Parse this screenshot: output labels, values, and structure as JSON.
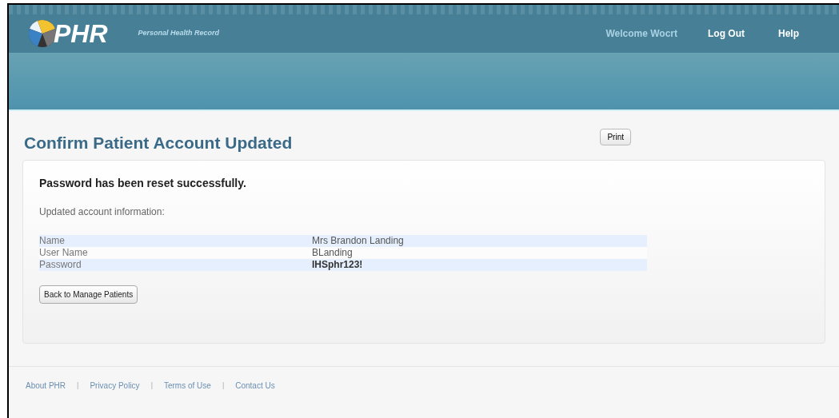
{
  "header": {
    "logo": "PHR",
    "tagline": "Personal Health Record",
    "welcome": "Welcome Wocrt",
    "nav": [
      "Log Out",
      "Help"
    ]
  },
  "page": {
    "title": "Confirm Patient Account Updated",
    "print_button": "Print"
  },
  "card": {
    "message": "Password has been reset successfully.",
    "intro": "Updated account information:",
    "rows": [
      {
        "label": "Name",
        "value": "Mrs Brandon Landing",
        "shaded": true,
        "emphasized": false
      },
      {
        "label": "User Name",
        "value": "BLanding",
        "shaded": false,
        "emphasized": false
      },
      {
        "label": "Password",
        "value": "IHSphr123!",
        "shaded": true,
        "emphasized": true
      }
    ],
    "back_button": "Back to Manage Patients"
  },
  "footer": [
    {
      "kind": "link",
      "text": "About PHR"
    },
    {
      "kind": "separator",
      "text": "|"
    },
    {
      "kind": "link",
      "text": "Privacy Policy"
    },
    {
      "kind": "separator",
      "text": "|"
    },
    {
      "kind": "link",
      "text": "Terms of Use"
    },
    {
      "kind": "separator",
      "text": "|"
    },
    {
      "kind": "link",
      "text": "Contact Us"
    }
  ]
}
